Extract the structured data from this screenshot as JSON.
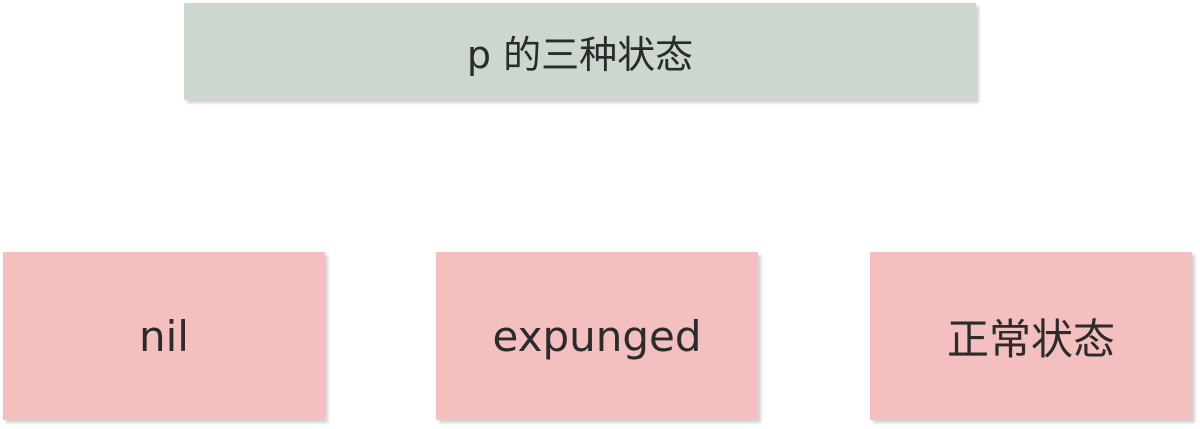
{
  "diagram": {
    "title": "p 的三种状态",
    "states": [
      {
        "label": "nil"
      },
      {
        "label": "expunged"
      },
      {
        "label": "正常状态"
      }
    ]
  },
  "colors": {
    "title_fill": "#ccd7cd",
    "state_fill": "#f4bfbf",
    "text": "#2b2b2b"
  }
}
